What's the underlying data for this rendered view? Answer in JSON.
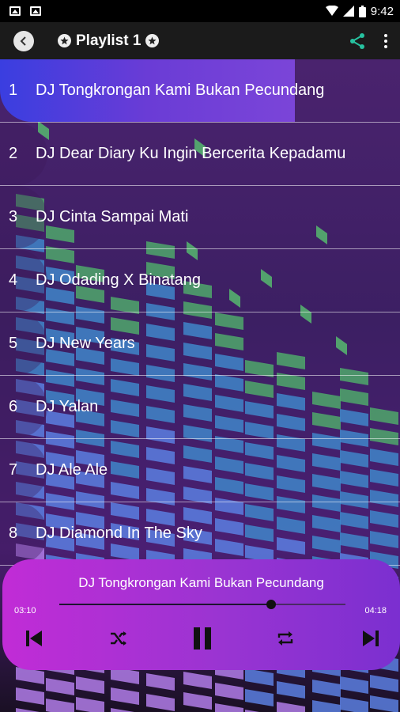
{
  "status_bar": {
    "time": "9:42"
  },
  "app_bar": {
    "title": "Playlist 1"
  },
  "playlist": [
    {
      "number": "1",
      "title": "DJ Tongkrongan Kami Bukan Pecundang"
    },
    {
      "number": "2",
      "title": "DJ Dear Diary Ku Ingin Bercerita Kepadamu"
    },
    {
      "number": "3",
      "title": "DJ Cinta Sampai Mati"
    },
    {
      "number": "4",
      "title": "DJ Odading X Binatang"
    },
    {
      "number": "5",
      "title": "DJ New Years"
    },
    {
      "number": "6",
      "title": "DJ Yalan"
    },
    {
      "number": "7",
      "title": "DJ Ale Ale"
    },
    {
      "number": "8",
      "title": "DJ Diamond In The Sky"
    }
  ],
  "player": {
    "now_playing": "DJ Tongkrongan Kami Bukan Pecundang",
    "elapsed": "03:10",
    "duration": "04:18",
    "progress": 0.74
  },
  "colors": {
    "active_row": "#5a3ddb",
    "player_start": "#c12cd6",
    "player_end": "#7b2fd0",
    "share_icon": "#27c2a0"
  },
  "icons": [
    "back-icon",
    "star-icon",
    "share-icon",
    "more-vert-icon",
    "skip-previous-icon",
    "shuffle-icon",
    "pause-icon",
    "repeat-icon",
    "skip-next-icon"
  ]
}
